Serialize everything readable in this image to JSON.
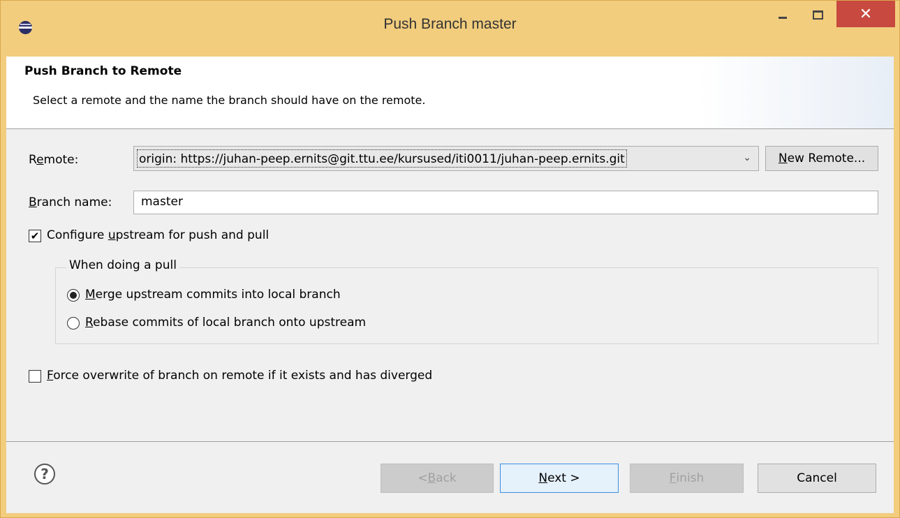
{
  "window": {
    "title": "Push Branch master",
    "close_glyph": "✕"
  },
  "header": {
    "title": "Push Branch to Remote",
    "description": "Select a remote and the name the branch should have on the remote."
  },
  "form": {
    "remote_label_prefix": "R",
    "remote_label_mnemonic": "e",
    "remote_label_suffix": "mote:",
    "remote_value": "origin: https://juhan-peep.ernits@git.ttu.ee/kursused/iti0011/juhan-peep.ernits.git",
    "new_remote_mnemonic": "N",
    "new_remote_suffix": "ew Remote...",
    "branch_label_mnemonic": "B",
    "branch_label_suffix": "ranch name:",
    "branch_value": "master",
    "configure_prefix": "Configure ",
    "configure_mnemonic": "u",
    "configure_suffix": "pstream for push and pull",
    "configure_checked": true,
    "pull_group_title": "When doing a pull",
    "merge_mnemonic": "M",
    "merge_suffix": "erge upstream commits into local branch",
    "merge_selected": true,
    "rebase_mnemonic": "R",
    "rebase_suffix": "ebase commits of local branch onto upstream",
    "force_mnemonic": "F",
    "force_suffix": "orce overwrite of branch on remote if it exists and has diverged",
    "force_checked": false
  },
  "footer": {
    "back_prefix": "< ",
    "back_mnemonic": "B",
    "back_suffix": "ack",
    "next_mnemonic": "N",
    "next_suffix": "ext >",
    "finish_mnemonic": "F",
    "finish_suffix": "inish",
    "cancel_label": "Cancel"
  },
  "icons": {
    "app": "eclipse-icon",
    "dropdown": "chevron-down-icon",
    "help": "help-icon",
    "check_glyph": "✔",
    "chevron_glyph": "⌄",
    "help_glyph": "?"
  }
}
